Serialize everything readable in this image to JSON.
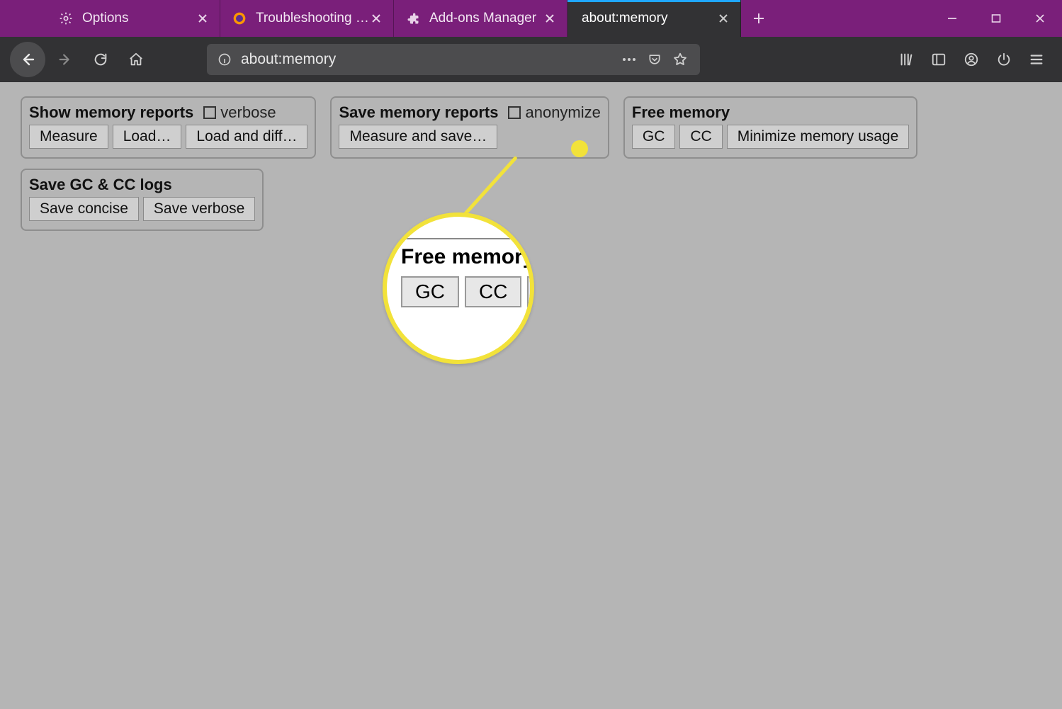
{
  "window": {
    "tabs": [
      {
        "label": "Options"
      },
      {
        "label": "Troubleshooting Information"
      },
      {
        "label": "Add-ons Manager"
      },
      {
        "label": "about:memory",
        "active": true
      }
    ]
  },
  "urlbar": {
    "value": "about:memory"
  },
  "page": {
    "show_reports": {
      "title": "Show memory reports",
      "verbose_label": "verbose",
      "buttons": {
        "measure": "Measure",
        "load": "Load…",
        "load_diff": "Load and diff…"
      }
    },
    "save_reports": {
      "title": "Save memory reports",
      "anonymize_label": "anonymize",
      "buttons": {
        "measure_save": "Measure and save…"
      }
    },
    "free_memory": {
      "title": "Free memory",
      "buttons": {
        "gc": "GC",
        "cc": "CC",
        "minimize": "Minimize memory usage"
      }
    },
    "save_logs": {
      "title": "Save GC & CC logs",
      "buttons": {
        "concise": "Save concise",
        "verbose": "Save verbose"
      }
    }
  },
  "callout": {
    "title": "Free memory",
    "gc": "GC",
    "cc": "CC"
  }
}
